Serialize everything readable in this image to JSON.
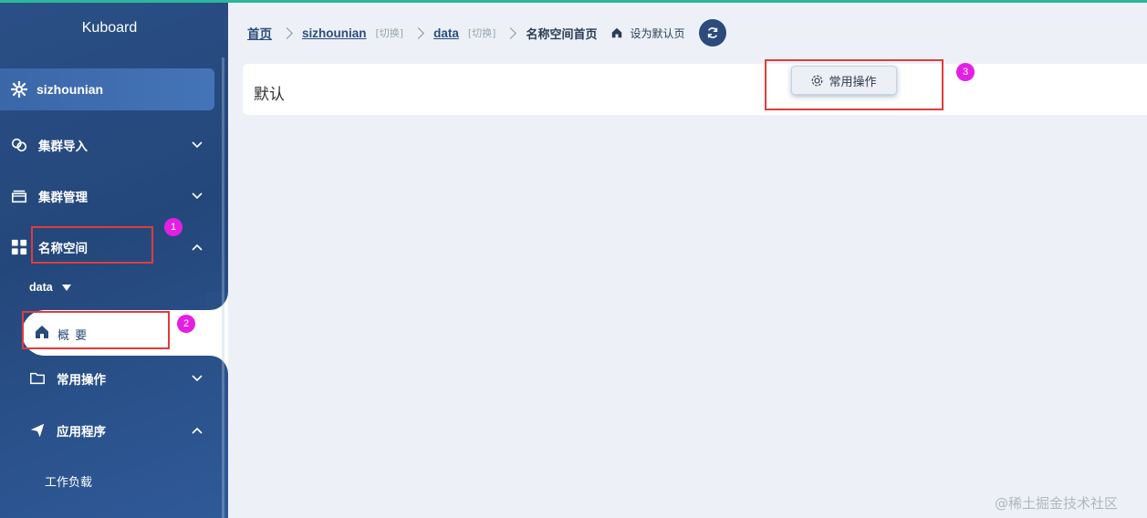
{
  "app": {
    "title": "Kuboard"
  },
  "sidebar": {
    "cluster": "sizhounian",
    "menu": [
      {
        "label": "集群导入",
        "icon": "link-icon",
        "state": "collapsed"
      },
      {
        "label": "集群管理",
        "icon": "server-icon",
        "state": "collapsed"
      },
      {
        "label": "名称空间",
        "icon": "grid-icon",
        "state": "expanded"
      }
    ],
    "namespace": "data",
    "overview": "概 要",
    "submenu": [
      {
        "label": "常用操作",
        "icon": "folder-icon",
        "state": "collapsed"
      },
      {
        "label": "应用程序",
        "icon": "send-icon",
        "state": "expanded"
      }
    ],
    "workload": "工作负载"
  },
  "breadcrumb": {
    "home": "首页",
    "cluster": "sizhounian",
    "cluster_switch": "[切换]",
    "namespace": "data",
    "namespace_switch": "[切换]",
    "current": "名称空间首页",
    "set_default": "设为默认页"
  },
  "main": {
    "card_title": "默认",
    "ops_button": "常用操作"
  },
  "annotations": [
    "1",
    "2",
    "3"
  ],
  "watermark": "@稀土掘金技术社区",
  "colors": {
    "sidebar": "#24477b",
    "accent": "#2bb89a",
    "annotation": "#e03c3c",
    "badge": "#e41fe4"
  }
}
